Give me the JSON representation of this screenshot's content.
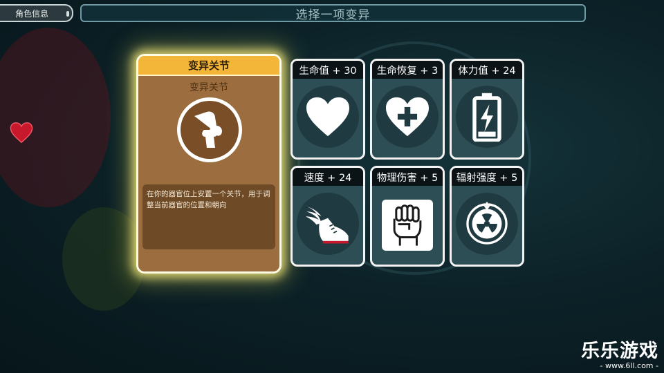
{
  "hud": {
    "character_info_label": "角色信息",
    "title": "选择一项变异"
  },
  "selected_mutation": {
    "header": "变异关节",
    "subtitle": "变异关节",
    "icon": "knee-joint-icon",
    "description": "在你的器官位上安置一个关节，用于调整当前器官的位置和朝向"
  },
  "mutation_options": [
    {
      "label": "生命值 + 30",
      "icon": "heart-icon"
    },
    {
      "label": "生命恢复 + 3",
      "icon": "heart-plus-icon"
    },
    {
      "label": "体力值 + 24",
      "icon": "battery-bolt-icon"
    },
    {
      "label": "速度 + 24",
      "icon": "winged-shoe-icon"
    },
    {
      "label": "物理伤害 + 5",
      "icon": "fist-icon"
    },
    {
      "label": "辐射强度 + 5",
      "icon": "radiation-icon"
    }
  ],
  "watermark": {
    "title": "乐乐游戏",
    "url": "- www.6ll.com -"
  },
  "colors": {
    "selected_header": "#f3b639",
    "selected_body": "#9c6d3e",
    "card_body": "#2e4e55",
    "glow": "#fff282"
  }
}
